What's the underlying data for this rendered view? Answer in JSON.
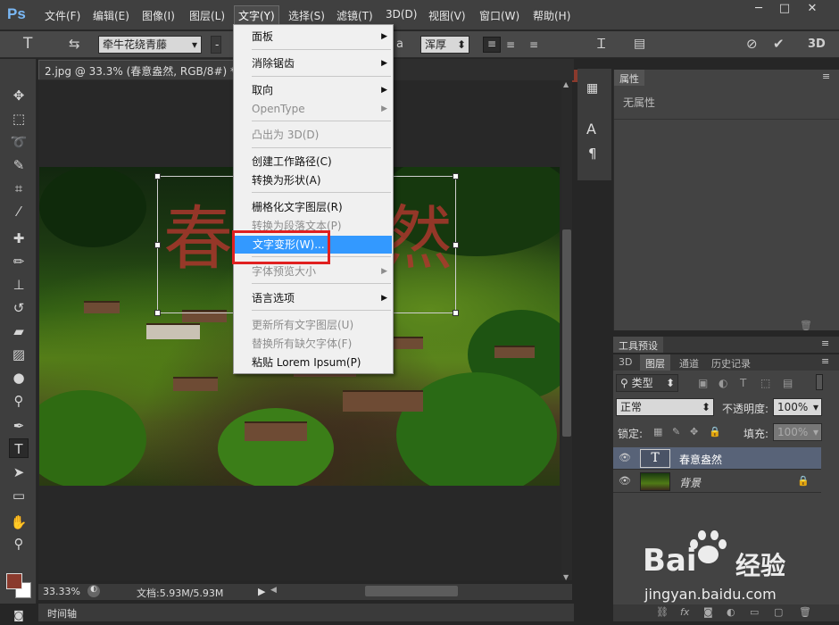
{
  "app": {
    "logo": "Ps"
  },
  "menubar": {
    "items": [
      "文件(F)",
      "编辑(E)",
      "图像(I)",
      "图层(L)",
      "文字(Y)",
      "选择(S)",
      "滤镜(T)",
      "3D(D)",
      "视图(V)",
      "窗口(W)",
      "帮助(H)"
    ],
    "active_index": 4,
    "window_buttons": [
      "─",
      "□",
      "✕"
    ]
  },
  "options_bar": {
    "tool_icon": "T",
    "font_family": "牵牛花绕青藤",
    "antialias_icon": "a",
    "antialias_value": "浑厚",
    "align_icons": [
      "align-left-icon",
      "align-center-icon",
      "align-right-icon"
    ],
    "text_color": "#8a3a2d",
    "right_buttons": [
      "cancel-icon",
      "commit-icon"
    ],
    "mode_3d": "3D"
  },
  "document": {
    "tab_title": "2.jpg @ 33.3% (春意盎然, RGB/8#) *",
    "close_glyph": "×",
    "text_layer_content": "春意盎然",
    "zoom": "33.33%",
    "doc_size": "文档:5.93M/5.93M"
  },
  "text_menu": {
    "items": [
      {
        "label": "面板",
        "submenu": true,
        "enabled": true
      },
      {
        "label": "消除锯齿",
        "submenu": true,
        "enabled": true
      },
      {
        "label": "取向",
        "submenu": true,
        "enabled": true
      },
      {
        "label": "OpenType",
        "submenu": true,
        "enabled": false
      },
      {
        "label": "凸出为 3D(D)",
        "submenu": false,
        "enabled": false
      },
      {
        "label": "创建工作路径(C)",
        "submenu": false,
        "enabled": true
      },
      {
        "label": "转换为形状(A)",
        "submenu": false,
        "enabled": true
      },
      {
        "label": "栅格化文字图层(R)",
        "submenu": false,
        "enabled": true
      },
      {
        "label": "转换为段落文本(P)",
        "submenu": false,
        "enabled": false
      },
      {
        "label": "文字变形(W)...",
        "submenu": false,
        "enabled": true,
        "highlighted": true
      },
      {
        "label": "字体预览大小",
        "submenu": true,
        "enabled": false
      },
      {
        "label": "语言选项",
        "submenu": true,
        "enabled": true
      },
      {
        "label": "更新所有文字图层(U)",
        "submenu": false,
        "enabled": false
      },
      {
        "label": "替换所有缺欠字体(F)",
        "submenu": false,
        "enabled": false
      },
      {
        "label": "粘贴 Lorem Ipsum(P)",
        "submenu": false,
        "enabled": true
      }
    ]
  },
  "properties_panel": {
    "tab": "属性",
    "empty_text": "无属性"
  },
  "adjust_panel": {
    "tab": "工具预设"
  },
  "layers_panel": {
    "tabs": [
      "3D",
      "图层",
      "通道",
      "历史记录"
    ],
    "active_tab": "图层",
    "filter_label": "类型",
    "blend_mode": "正常",
    "opacity_label": "不透明度:",
    "opacity_value": "100%",
    "lock_label": "锁定:",
    "fill_label": "填充:",
    "fill_value": "100%",
    "layers": [
      {
        "name": "春意盎然",
        "type": "text",
        "thumb": "T",
        "selected": true
      },
      {
        "name": "背景",
        "type": "image",
        "locked": true,
        "selected": false
      }
    ]
  },
  "timeline": {
    "label": "时间轴"
  },
  "watermark": {
    "brand": "Bai",
    "brand_cn": "经验",
    "url": "jingyan.baidu.com"
  }
}
